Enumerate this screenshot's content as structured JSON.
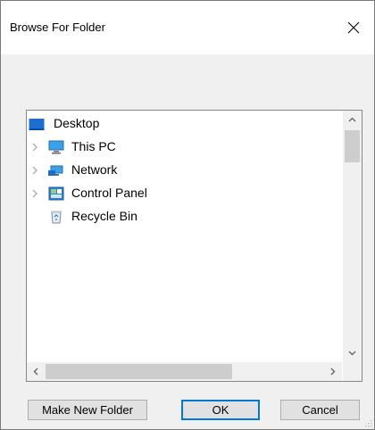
{
  "window": {
    "title": "Browse For Folder"
  },
  "tree": {
    "items": [
      {
        "label": "Desktop",
        "icon": "desktop-icon",
        "level": 0,
        "expandable": false
      },
      {
        "label": "This PC",
        "icon": "computer-icon",
        "level": 1,
        "expandable": true
      },
      {
        "label": "Network",
        "icon": "network-icon",
        "level": 1,
        "expandable": true
      },
      {
        "label": "Control Panel",
        "icon": "control-panel-icon",
        "level": 1,
        "expandable": true
      },
      {
        "label": "Recycle Bin",
        "icon": "recycle-bin-icon",
        "level": 1,
        "expandable": false
      }
    ]
  },
  "buttons": {
    "make_new_folder": "Make New Folder",
    "ok": "OK",
    "cancel": "Cancel"
  },
  "colors": {
    "accent": "#0078d7",
    "dialog_bg": "#f0f0f0"
  }
}
